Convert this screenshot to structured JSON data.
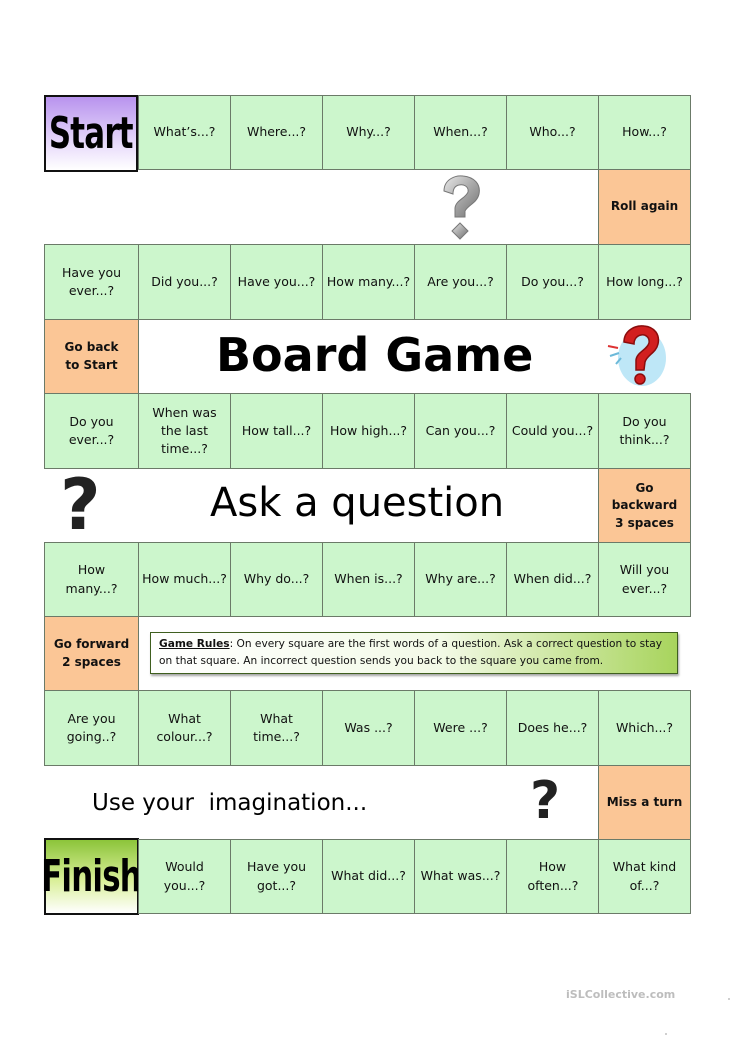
{
  "board": {
    "title": "Board Game",
    "subtitle": "Ask a question",
    "imagination_text": "Use your  imagination...",
    "start_label": "Start",
    "finish_label": "Finish",
    "colors": {
      "question_square": "#ccf6cc",
      "special_square": "#fbc696",
      "start_gradient_top": "#b893ee",
      "finish_gradient_top": "#8cc43a",
      "grid_line": "#6b7a68"
    },
    "rows": [
      [
        "What’s...?",
        "Where...?",
        "Why...?",
        "When...?",
        "Who...?",
        "How...?"
      ],
      [
        "Have you ever...?",
        "Did you...?",
        "Have you...?",
        "How many...?",
        "Are you...?",
        "Do you...?",
        "How long...?"
      ],
      [
        "Do you ever...?",
        "When was the last time...?",
        "How tall...?",
        "How high...?",
        "Can you...?",
        "Could you...?",
        "Do you think...?"
      ],
      [
        "How many...?",
        "How much...?",
        "Why do...?",
        "When is...?",
        "Why are...?",
        "When did...?",
        "Will you ever...?"
      ],
      [
        "Are you going..?",
        "What colour...?",
        "What time...?",
        "Was ...?",
        "Were ...?",
        "Does he...?",
        "Which...?"
      ],
      [
        "Would you...?",
        "Have you got...?",
        "What did...?",
        "What was...?",
        "How often...?",
        "What kind of...?"
      ]
    ],
    "special_squares": {
      "roll_again": "Roll again",
      "go_back_to_start": "Go back to Start",
      "go_backward": "Go backward 3 spaces",
      "go_forward": "Go forward 2 spaces",
      "miss_a_turn": "Miss a turn"
    },
    "rules": {
      "heading": "Game Rules",
      "text": ": On every square are the first words of a question. Ask a correct question to stay on that square. An incorrect question sends you back to the square you came from."
    },
    "icons": [
      "silver-question-mark-icon",
      "red-3d-question-mark-icon",
      "black-question-mark-icon",
      "black-question-mark-icon"
    ]
  },
  "watermark": "iSLCollective.com"
}
